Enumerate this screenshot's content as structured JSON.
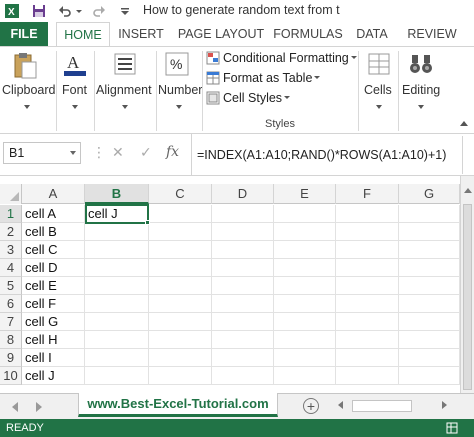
{
  "app": {
    "title": "How to generate random text from t",
    "brand_color": "#217346"
  },
  "ribbon_tabs": [
    {
      "label": "FILE",
      "state": "file"
    },
    {
      "label": "HOME",
      "state": "active"
    },
    {
      "label": "INSERT",
      "state": ""
    },
    {
      "label": "PAGE LAYOUT",
      "state": ""
    },
    {
      "label": "FORMULAS",
      "state": ""
    },
    {
      "label": "DATA",
      "state": ""
    },
    {
      "label": "REVIEW",
      "state": ""
    }
  ],
  "ribbon": {
    "clipboard": "Clipboard",
    "font": "Font",
    "alignment": "Alignment",
    "number": "Number",
    "conditional_formatting": "Conditional Formatting",
    "format_as_table": "Format as Table",
    "cell_styles": "Cell Styles",
    "styles_group": "Styles",
    "cells": "Cells",
    "editing": "Editing"
  },
  "formula_bar": {
    "name_box": "B1",
    "formula": "=INDEX(A1:A10;RAND()*ROWS(A1:A10)+1)",
    "fx": "fx"
  },
  "grid": {
    "columns": [
      "A",
      "B",
      "C",
      "D",
      "E",
      "F",
      "G"
    ],
    "selected_column": "B",
    "selected_row": 1,
    "rows": [
      {
        "num": "1",
        "a": "cell A",
        "b": "cell J"
      },
      {
        "num": "2",
        "a": "cell B",
        "b": ""
      },
      {
        "num": "3",
        "a": "cell C",
        "b": ""
      },
      {
        "num": "4",
        "a": "cell D",
        "b": ""
      },
      {
        "num": "5",
        "a": "cell E",
        "b": ""
      },
      {
        "num": "6",
        "a": "cell F",
        "b": ""
      },
      {
        "num": "7",
        "a": "cell G",
        "b": ""
      },
      {
        "num": "8",
        "a": "cell H",
        "b": ""
      },
      {
        "num": "9",
        "a": "cell I",
        "b": ""
      },
      {
        "num": "10",
        "a": "cell J",
        "b": ""
      }
    ]
  },
  "sheet_tab": "www.Best-Excel-Tutorial.com",
  "status": "READY"
}
